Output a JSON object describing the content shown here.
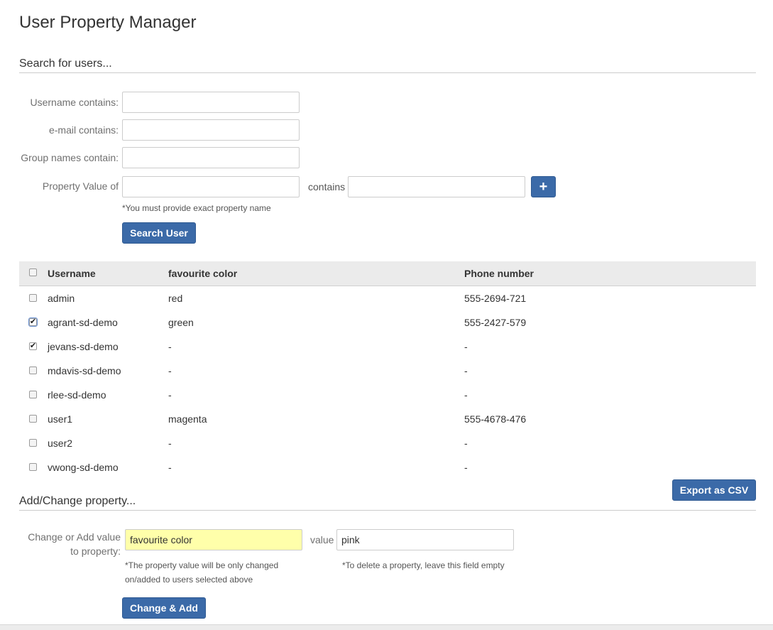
{
  "page": {
    "title": "User Property Manager"
  },
  "search": {
    "section_title": "Search for users...",
    "username_label": "Username contains:",
    "username_value": "",
    "email_label": "e-mail contains:",
    "email_value": "",
    "groups_label": "Group names contain:",
    "groups_value": "",
    "property_label": "Property Value of",
    "property_value": "",
    "contains_label": "contains",
    "contains_value": "",
    "add_icon": "+",
    "hint": "*You must provide exact property name",
    "search_button": "Search User"
  },
  "table": {
    "headers": [
      "Username",
      "favourite color",
      "Phone number"
    ],
    "rows": [
      {
        "checked": false,
        "username": "admin",
        "color": "red",
        "phone": "555-2694-721"
      },
      {
        "checked": true,
        "username": "agrant-sd-demo",
        "color": "green",
        "phone": "555-2427-579"
      },
      {
        "checked": true,
        "username": "jevans-sd-demo",
        "color": "-",
        "phone": "-"
      },
      {
        "checked": false,
        "username": "mdavis-sd-demo",
        "color": "-",
        "phone": "-"
      },
      {
        "checked": false,
        "username": "rlee-sd-demo",
        "color": "-",
        "phone": "-"
      },
      {
        "checked": false,
        "username": "user1",
        "color": "magenta",
        "phone": "555-4678-476"
      },
      {
        "checked": false,
        "username": "user2",
        "color": "-",
        "phone": "-"
      },
      {
        "checked": false,
        "username": "vwong-sd-demo",
        "color": "-",
        "phone": "-"
      }
    ],
    "export_button": "Export as CSV"
  },
  "change": {
    "section_title": "Add/Change property...",
    "label_line1": "Change or Add value",
    "label_line2": "to property:",
    "property_value": "favourite color",
    "value_label": "value",
    "value_value": "pink",
    "hint_property_line1": "*The property value will be only changed",
    "hint_property_line2": "on/added to users selected above",
    "hint_value": "*To delete a property, leave this field empty",
    "submit_button": "Change & Add"
  },
  "colors": {
    "primary_button": "#3b6aa8",
    "highlight_field": "#ffffaa",
    "table_header_bg": "#ebebeb"
  }
}
